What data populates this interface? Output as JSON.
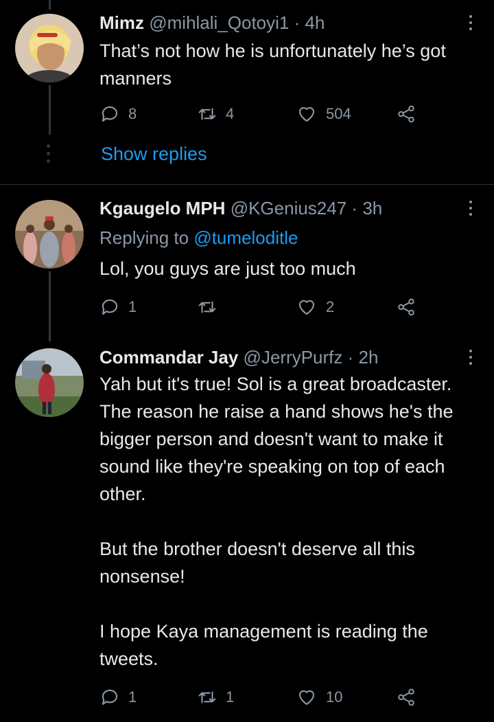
{
  "tweets": [
    {
      "name": "Mimz",
      "handle": "@mihlali_Qotoyi1",
      "time": "4h",
      "text": [
        "That’s not how he is unfortunately he’s got manners"
      ],
      "replies": "8",
      "retweets": "4",
      "likes": "504",
      "show_replies": "Show replies"
    },
    {
      "name": "Kgaugelo MPH",
      "handle": "@KGenius247",
      "time": "3h",
      "replying_prefix": "Replying to",
      "replying_to": "@tumeloditle",
      "text": [
        "Lol, you guys are just too much"
      ],
      "replies": "1",
      "retweets": "",
      "likes": "2"
    },
    {
      "name": "Commandar Jay",
      "handle": "@JerryPurfz",
      "time": "2h",
      "text": [
        "Yah but it's true! Sol is a great broadcaster. The reason he raise a hand shows he's the bigger person and doesn't want to make it sound like they're speaking on top of each other.",
        "But the brother doesn't deserve all this nonsense!",
        "I hope Kaya management is reading the tweets."
      ],
      "replies": "1",
      "retweets": "1",
      "likes": "10"
    }
  ],
  "separator": "·",
  "icons": {
    "reply": "reply-icon",
    "retweet": "retweet-icon",
    "like": "heart-icon",
    "share": "share-icon",
    "more": "more-icon"
  },
  "colors": {
    "background": "#000000",
    "text": "#e7e9ea",
    "muted": "#8b98a5",
    "link": "#1d9bf0"
  }
}
